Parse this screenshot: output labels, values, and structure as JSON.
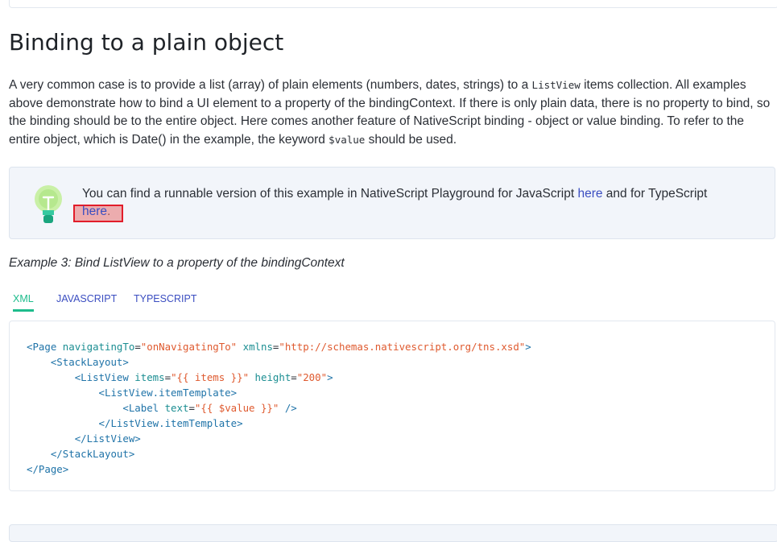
{
  "section": {
    "title": "Binding to a plain object",
    "paragraph": {
      "part1": "A very common case is to provide a list (array) of plain elements (numbers, dates, strings) to a ",
      "code1": "ListView",
      "part2": " items collection. All examples above demonstrate how to bind a UI element to a property of the bindingContext. If there is only plain data, there is no property to bind, so the binding should be to the entire object. Here comes another feature of NativeScript binding - object or value binding. To refer to the entire object, which is Date() in the example, the keyword ",
      "code2": "$value",
      "part3": " should be used."
    }
  },
  "tip": {
    "icon": "lightbulb-icon",
    "text_before": "You can find a runnable version of this example in NativeScript Playground for JavaScript ",
    "link_js": "here",
    "text_middle": " and for TypeScript ",
    "link_ts": "here",
    "text_end": "."
  },
  "example": {
    "caption": "Example 3: Bind ListView to a property of the bindingContext",
    "tabs": [
      {
        "label": "XML",
        "active": true
      },
      {
        "label": "JAVASCRIPT",
        "active": false
      },
      {
        "label": "TYPESCRIPT",
        "active": false
      }
    ]
  },
  "code": {
    "l1_tag_open": "<Page",
    "l1_attr1": "navigatingTo",
    "l1_val1": "\"onNavigatingTo\"",
    "l1_attr2": "xmlns",
    "l1_val2": "\"http://schemas.nativescript.org/tns.xsd\"",
    "l1_close": ">",
    "l2": "<StackLayout>",
    "l3_tag": "<ListView",
    "l3_attr1": "items",
    "l3_val1": "\"{{ items }}\"",
    "l3_attr2": "height",
    "l3_val2": "\"200\"",
    "l3_close": ">",
    "l4": "<ListView.itemTemplate>",
    "l5_tag": "<Label",
    "l5_attr": "text",
    "l5_val": "\"{{ $value }}\"",
    "l5_close": "/>",
    "l6": "</ListView.itemTemplate>",
    "l7": "</ListView>",
    "l8": "</StackLayout>",
    "l9": "</Page>"
  },
  "colors": {
    "accent": "#1ebc8c",
    "link": "#3b4ec1",
    "highlight_border": "#e11d2a",
    "tip_bg": "#f2f5fa"
  }
}
